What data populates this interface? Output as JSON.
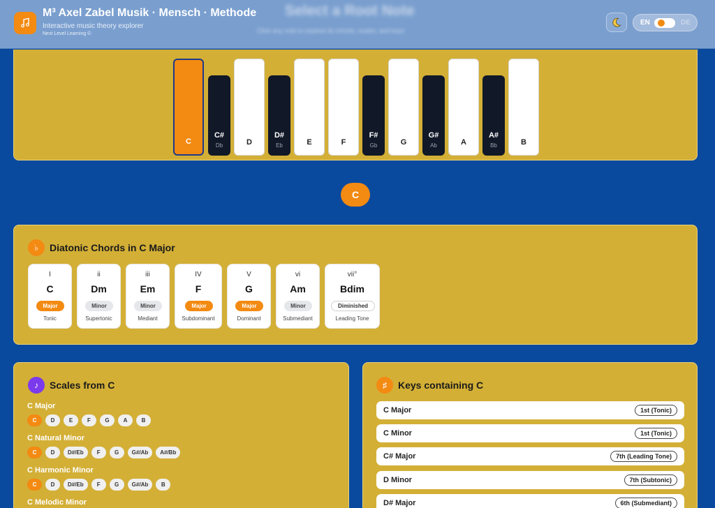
{
  "header": {
    "title": "M³ Axel Zabel Musik · Mensch · Methode",
    "subtitle": "Interactive music theory explorer",
    "tagline": "Next Level Learning ©",
    "page_heading": "Select a Root Note",
    "page_subheading": "Click any note to explore its chords, scales, and keys",
    "lang_left": "EN",
    "lang_right": "DE",
    "icons": {
      "logo": "music-note-icon",
      "theme": "moon-icon"
    }
  },
  "piano": {
    "selected": "C",
    "white_keys": [
      {
        "name": "C"
      },
      {
        "name": "D"
      },
      {
        "name": "E"
      },
      {
        "name": "F"
      },
      {
        "name": "G"
      },
      {
        "name": "A"
      },
      {
        "name": "B"
      }
    ],
    "black_keys": [
      {
        "name": "C#",
        "alt": "Db"
      },
      {
        "name": "D#",
        "alt": "Eb"
      },
      {
        "name": "F#",
        "alt": "Gb"
      },
      {
        "name": "G#",
        "alt": "Ab"
      },
      {
        "name": "A#",
        "alt": "Bb"
      }
    ]
  },
  "root_badge": "C",
  "diatonic": {
    "title": "Diatonic Chords in C Major",
    "icon": "flat-icon",
    "chords": [
      {
        "roman": "I",
        "name": "C",
        "quality": "Major",
        "function": "Tonic"
      },
      {
        "roman": "ii",
        "name": "Dm",
        "quality": "Minor",
        "function": "Supertonic"
      },
      {
        "roman": "iii",
        "name": "Em",
        "quality": "Minor",
        "function": "Mediant"
      },
      {
        "roman": "IV",
        "name": "F",
        "quality": "Major",
        "function": "Subdominant"
      },
      {
        "roman": "V",
        "name": "G",
        "quality": "Major",
        "function": "Dominant"
      },
      {
        "roman": "vi",
        "name": "Am",
        "quality": "Minor",
        "function": "Submediant"
      },
      {
        "roman": "vii°",
        "name": "Bdim",
        "quality": "Diminished",
        "function": "Leading Tone"
      }
    ]
  },
  "scales": {
    "title": "Scales from C",
    "icon": "note-icon",
    "list": [
      {
        "name": "C Major",
        "notes": [
          "C",
          "D",
          "E",
          "F",
          "G",
          "A",
          "B"
        ]
      },
      {
        "name": "C Natural Minor",
        "notes": [
          "C",
          "D",
          "D#/Eb",
          "F",
          "G",
          "G#/Ab",
          "A#/Bb"
        ]
      },
      {
        "name": "C Harmonic Minor",
        "notes": [
          "C",
          "D",
          "D#/Eb",
          "F",
          "G",
          "G#/Ab",
          "B"
        ]
      },
      {
        "name": "C Melodic Minor",
        "notes": []
      }
    ]
  },
  "keys": {
    "title": "Keys containing C",
    "icon": "sharp-icon",
    "list": [
      {
        "name": "C Major",
        "role": "1st (Tonic)"
      },
      {
        "name": "C Minor",
        "role": "1st (Tonic)"
      },
      {
        "name": "C# Major",
        "role": "7th (Leading Tone)"
      },
      {
        "name": "D Minor",
        "role": "7th (Subtonic)"
      },
      {
        "name": "D# Major",
        "role": "6th (Submediant)"
      }
    ]
  },
  "colors": {
    "background": "#0a4a9e",
    "panel": "#d3af36",
    "accent": "#f38a12",
    "scales_icon": "#7c3aed"
  }
}
